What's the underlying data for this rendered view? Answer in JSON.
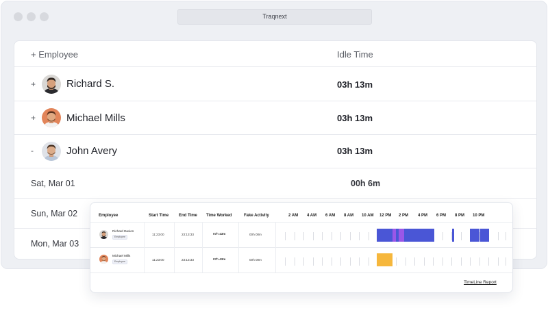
{
  "window": {
    "title": "Traqnext"
  },
  "table": {
    "col_employee": "+ Employee",
    "col_idle": "Idle Time",
    "employees": [
      {
        "toggle": "+",
        "name": "Richard S.",
        "idle": "03h 13m"
      },
      {
        "toggle": "+",
        "name": "Michael Mills",
        "idle": "03h 13m"
      },
      {
        "toggle": "-",
        "name": "John Avery",
        "idle": "03h 13m"
      }
    ],
    "days": [
      {
        "date": "Sat, Mar 01",
        "idle": "00h 6m"
      },
      {
        "date": "Sun, Mar 02"
      },
      {
        "date": "Mon, Mar 03"
      }
    ]
  },
  "timeline": {
    "headers": [
      "Employee",
      "Start Time",
      "End Time",
      "Time Worked",
      "Fake Activity"
    ],
    "hours": [
      "2 AM",
      "4 AM",
      "6 AM",
      "8 AM",
      "10 AM",
      "12 PM",
      "2 PM",
      "4 PM",
      "6 PM",
      "8 PM",
      "10 PM"
    ],
    "rows": [
      {
        "name": "Richard Davies",
        "role": "Employee",
        "start": "11:23:00",
        "end": "23:13:33",
        "worked": "07h 43m",
        "fake": "00h 00m"
      },
      {
        "name": "Michael Mills",
        "role": "Employee",
        "start": "11:23:00",
        "end": "23:13:33",
        "worked": "07h 43m",
        "fake": "00h 00m"
      }
    ],
    "report_link": "TimeLine Report",
    "colors": {
      "active": "#4a56d6",
      "fake": "#9a57e8",
      "idle": "#f6b73c"
    }
  }
}
